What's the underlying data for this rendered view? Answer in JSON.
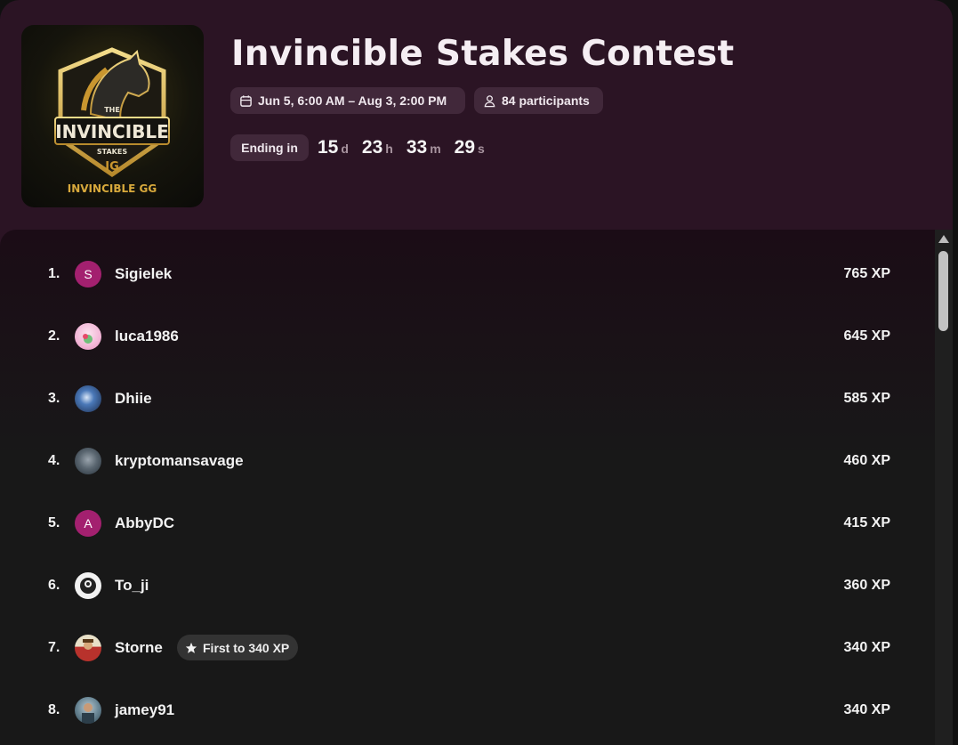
{
  "contest": {
    "title": "Invincible Stakes Contest",
    "date_range": "Jun 5, 6:00 AM – Aug 3, 2:00 PM",
    "participants": "84 participants",
    "ending_label": "Ending in",
    "logo": {
      "line1": "THE",
      "line2": "INVINCIBLE",
      "line3": "STAKES",
      "brand": "INVINCIBLE GG"
    },
    "countdown": [
      {
        "value": "15",
        "unit": "d"
      },
      {
        "value": "23",
        "unit": "h"
      },
      {
        "value": "33",
        "unit": "m"
      },
      {
        "value": "29",
        "unit": "s"
      }
    ]
  },
  "leaderboard": [
    {
      "rank": "1.",
      "name": "Sigielek",
      "xp": "765 XP",
      "avatar": {
        "type": "letter",
        "letter": "S",
        "color": "#a3206f"
      }
    },
    {
      "rank": "2.",
      "name": "luca1986",
      "xp": "645 XP",
      "avatar": {
        "type": "image",
        "color": "#f2b6d6"
      }
    },
    {
      "rank": "3.",
      "name": "Dhiie",
      "xp": "585 XP",
      "avatar": {
        "type": "image",
        "color": "#2a4f8a"
      }
    },
    {
      "rank": "4.",
      "name": "kryptomansavage",
      "xp": "460 XP",
      "avatar": {
        "type": "image",
        "color": "#3d4a55"
      }
    },
    {
      "rank": "5.",
      "name": "AbbyDC",
      "xp": "415 XP",
      "avatar": {
        "type": "letter",
        "letter": "A",
        "color": "#a3206f"
      }
    },
    {
      "rank": "6.",
      "name": "To_ji",
      "xp": "360 XP",
      "avatar": {
        "type": "image",
        "color": "#e8e8e8"
      }
    },
    {
      "rank": "7.",
      "name": "Storne",
      "xp": "340 XP",
      "avatar": {
        "type": "image",
        "color": "#b8322c"
      },
      "badge": "First to 340 XP"
    },
    {
      "rank": "8.",
      "name": "jamey91",
      "xp": "340 XP",
      "avatar": {
        "type": "image",
        "color": "#4f6b7a"
      }
    }
  ],
  "icons": {
    "calendar": "calendar-icon",
    "participants": "person-icon",
    "badge": "star-icon"
  }
}
